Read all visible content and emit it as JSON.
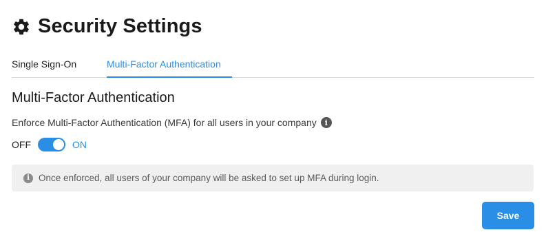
{
  "header": {
    "icon": "gear-icon",
    "title": "Security Settings"
  },
  "tabs": [
    {
      "label": "Single Sign-On",
      "active": false
    },
    {
      "label": "Multi-Factor Authentication",
      "active": true
    }
  ],
  "section": {
    "title": "Multi-Factor Authentication",
    "enforce_label": "Enforce Multi-Factor Authentication (MFA) for all users in your company",
    "info_icon": "info-icon"
  },
  "toggle": {
    "off_label": "OFF",
    "on_label": "ON",
    "state": "on"
  },
  "notice": {
    "icon": "info-icon",
    "text": "Once enforced, all users of your company will be asked to set up MFA during login."
  },
  "actions": {
    "save_label": "Save"
  },
  "colors": {
    "accent": "#2a8ee6",
    "notice_bg": "#f0f0f0",
    "text": "#1f1f1f"
  }
}
